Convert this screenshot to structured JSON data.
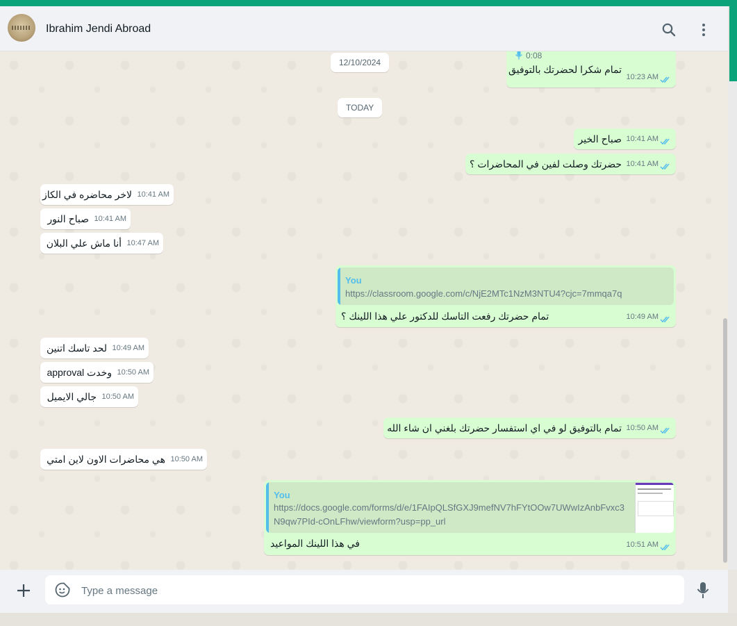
{
  "header": {
    "contact_name": "Ibrahim Jendi Abroad"
  },
  "dates": {
    "prev": "12/10/2024",
    "today": "TODAY"
  },
  "voice": {
    "duration": "0:08"
  },
  "messages": [
    {
      "text": "تمام شكرا لحضرتك بالتوفيق",
      "time": "10:23 AM"
    },
    {
      "text": "صباح الخير",
      "time": "10:41 AM"
    },
    {
      "text": "حضرتك وصلت لفين في المحاضرات ؟",
      "time": "10:41 AM"
    },
    {
      "text": "لاخر محاضره في الكاز",
      "time": "10:41 AM"
    },
    {
      "text": "صباح النور",
      "time": "10:41 AM"
    },
    {
      "text": "أنا ماش علي البلان",
      "time": "10:47 AM"
    },
    {
      "text": "تمام حضرتك رفعت التاسك للدكتور علي هذا اللينك ؟",
      "time": "10:49 AM",
      "quote_author": "You",
      "quote_url": "https://classroom.google.com/c/NjE2MTc1NzM3NTU4?cjc=7mmqa7q"
    },
    {
      "text": "لحد تاسك اتنين",
      "time": "10:49 AM"
    },
    {
      "text": "وخدت approval",
      "time": "10:50 AM"
    },
    {
      "text": "جالي الايميل",
      "time": "10:50 AM"
    },
    {
      "text": "تمام بالتوفيق لو في اي استفسار حضرتك بلغني ان شاء الله",
      "time": "10:50 AM"
    },
    {
      "text": "هي محاضرات الاون لاين امتي",
      "time": "10:50 AM"
    },
    {
      "text": "في هذا اللينك المواعيد",
      "time": "10:51 AM",
      "quote_author": "You",
      "quote_url_line1": "https://docs.google.com/forms/d/e/1FAIpQLSfGXJ9mefNV7hFYtOOw7UWwIzAnbFvxc3",
      "quote_url_line2": "N9qw7PId-cOnLFhw/viewform?usp=pp_url"
    }
  ],
  "composer": {
    "placeholder": "Type a message"
  },
  "colors": {
    "accent": "#0aa37a",
    "outgoing": "#d9fdd3",
    "incoming": "#ffffff",
    "read_ticks": "#53bdeb"
  }
}
